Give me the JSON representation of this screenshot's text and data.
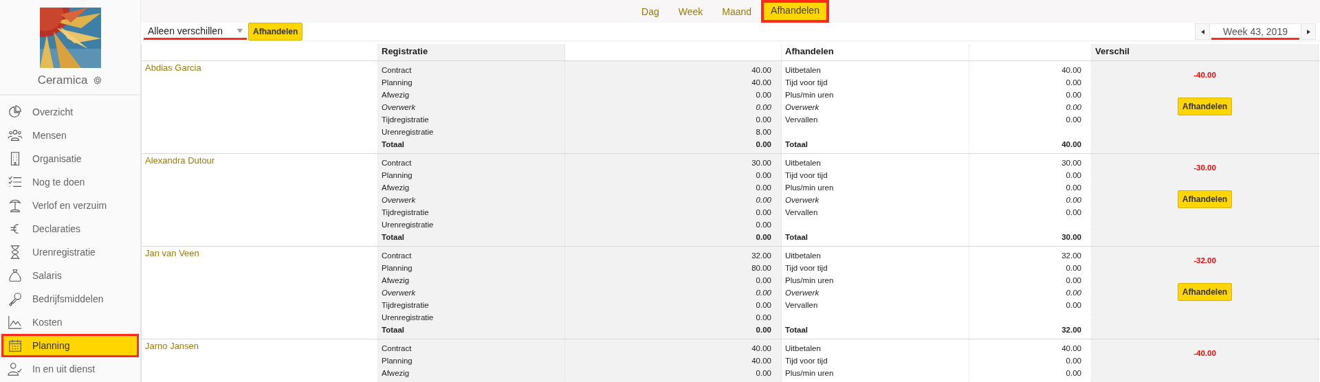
{
  "sidebar": {
    "company": "Ceramica",
    "items": [
      {
        "label": "Overzicht",
        "kind": "pie",
        "selected": false
      },
      {
        "label": "Mensen",
        "kind": "people",
        "selected": false
      },
      {
        "label": "Organisatie",
        "kind": "building",
        "selected": false
      },
      {
        "label": "Nog te doen",
        "kind": "checklist",
        "selected": false
      },
      {
        "label": "Verlof en verzuim",
        "kind": "palm",
        "selected": false
      },
      {
        "label": "Declaraties",
        "kind": "euro",
        "selected": false
      },
      {
        "label": "Urenregistratie",
        "kind": "hourglass",
        "selected": false
      },
      {
        "label": "Salaris",
        "kind": "bag",
        "selected": false
      },
      {
        "label": "Bedrijfsmiddelen",
        "kind": "key",
        "selected": false
      },
      {
        "label": "Kosten",
        "kind": "chart",
        "selected": false
      },
      {
        "label": "Planning",
        "kind": "calendar",
        "selected": true
      },
      {
        "label": "In en uit dienst",
        "kind": "person",
        "selected": false
      }
    ]
  },
  "tabs": [
    {
      "label": "Dag",
      "selected": false
    },
    {
      "label": "Week",
      "selected": false
    },
    {
      "label": "Maand",
      "selected": false
    },
    {
      "label": "Afhandelen",
      "selected": true
    }
  ],
  "toolbar": {
    "filter": {
      "value": "Alleen verschillen",
      "underlined": true
    },
    "button": "Afhandelen",
    "week": {
      "value": "Week 43, 2019",
      "underlined": true
    }
  },
  "table": {
    "columns": [
      "Registratie",
      "Afhandelen",
      "Verschil"
    ],
    "rows": [
      {
        "name": "Abdias Garcia",
        "registratie": [
          {
            "label": "Contract",
            "value": "40.00",
            "italic": false
          },
          {
            "label": "Planning",
            "value": "40.00",
            "italic": false
          },
          {
            "label": "Afwezig",
            "value": "0.00",
            "italic": false
          },
          {
            "label": "Overwerk",
            "value": "0.00",
            "italic": true
          },
          {
            "label": "Tijdregistratie",
            "value": "0.00",
            "italic": false
          },
          {
            "label": "Urenregistratie",
            "value": "8.00",
            "italic": false
          }
        ],
        "registratie_total": {
          "label": "Totaal",
          "value": "0.00"
        },
        "afhandelen": [
          {
            "label": "Uitbetalen",
            "value": "40.00",
            "italic": false
          },
          {
            "label": "Tijd voor tijd",
            "value": "0.00",
            "italic": false
          },
          {
            "label": "Plus/min uren",
            "value": "0.00",
            "italic": false
          },
          {
            "label": "Overwerk",
            "value": "0.00",
            "italic": true
          },
          {
            "label": "Vervallen",
            "value": "0.00",
            "italic": false
          }
        ],
        "afhandelen_total": {
          "label": "Totaal",
          "value": "40.00"
        },
        "verschil": "-40.00",
        "button": "Afhandelen"
      },
      {
        "name": "Alexandra Dutour",
        "registratie": [
          {
            "label": "Contract",
            "value": "30.00",
            "italic": false
          },
          {
            "label": "Planning",
            "value": "0.00",
            "italic": false
          },
          {
            "label": "Afwezig",
            "value": "0.00",
            "italic": false
          },
          {
            "label": "Overwerk",
            "value": "0.00",
            "italic": true
          },
          {
            "label": "Tijdregistratie",
            "value": "0.00",
            "italic": false
          },
          {
            "label": "Urenregistratie",
            "value": "0.00",
            "italic": false
          }
        ],
        "registratie_total": {
          "label": "Totaal",
          "value": "0.00"
        },
        "afhandelen": [
          {
            "label": "Uitbetalen",
            "value": "30.00",
            "italic": false
          },
          {
            "label": "Tijd voor tijd",
            "value": "0.00",
            "italic": false
          },
          {
            "label": "Plus/min uren",
            "value": "0.00",
            "italic": false
          },
          {
            "label": "Overwerk",
            "value": "0.00",
            "italic": true
          },
          {
            "label": "Vervallen",
            "value": "0.00",
            "italic": false
          }
        ],
        "afhandelen_total": {
          "label": "Totaal",
          "value": "30.00"
        },
        "verschil": "-30.00",
        "button": "Afhandelen"
      },
      {
        "name": "Jan van Veen",
        "registratie": [
          {
            "label": "Contract",
            "value": "32.00",
            "italic": false
          },
          {
            "label": "Planning",
            "value": "80.00",
            "italic": false
          },
          {
            "label": "Afwezig",
            "value": "0.00",
            "italic": false
          },
          {
            "label": "Overwerk",
            "value": "0.00",
            "italic": true
          },
          {
            "label": "Tijdregistratie",
            "value": "0.00",
            "italic": false
          },
          {
            "label": "Urenregistratie",
            "value": "0.00",
            "italic": false
          }
        ],
        "registratie_total": {
          "label": "Totaal",
          "value": "0.00"
        },
        "afhandelen": [
          {
            "label": "Uitbetalen",
            "value": "32.00",
            "italic": false
          },
          {
            "label": "Tijd voor tijd",
            "value": "0.00",
            "italic": false
          },
          {
            "label": "Plus/min uren",
            "value": "0.00",
            "italic": false
          },
          {
            "label": "Overwerk",
            "value": "0.00",
            "italic": true
          },
          {
            "label": "Vervallen",
            "value": "0.00",
            "italic": false
          }
        ],
        "afhandelen_total": {
          "label": "Totaal",
          "value": "32.00"
        },
        "verschil": "-32.00",
        "button": "Afhandelen"
      },
      {
        "name": "Jarno Jansen",
        "registratie": [
          {
            "label": "Contract",
            "value": "40.00",
            "italic": false
          },
          {
            "label": "Planning",
            "value": "40.00",
            "italic": false
          },
          {
            "label": "Afwezig",
            "value": "0.00",
            "italic": false
          }
        ],
        "afhandelen": [
          {
            "label": "Uitbetalen",
            "value": "40.00",
            "italic": false
          },
          {
            "label": "Tijd voor tijd",
            "value": "0.00",
            "italic": false
          },
          {
            "label": "Plus/min uren",
            "value": "0.00",
            "italic": false
          }
        ],
        "verschil": "-40.00"
      }
    ]
  }
}
